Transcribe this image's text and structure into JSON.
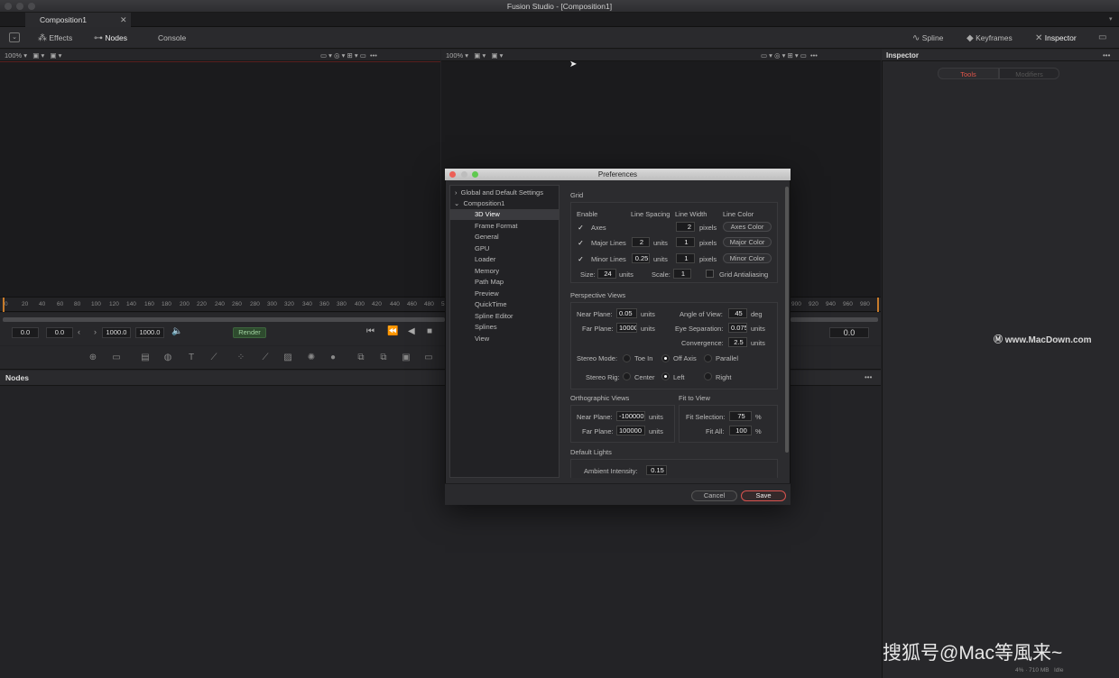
{
  "window": {
    "title": "Fusion Studio - [Composition1]"
  },
  "tabs": [
    {
      "label": "Composition1"
    }
  ],
  "toolbar": {
    "effects": "Effects",
    "nodes": "Nodes",
    "console": "Console",
    "spline": "Spline",
    "keyframes": "Keyframes",
    "inspector": "Inspector"
  },
  "viewer_left": {
    "zoom": "100%"
  },
  "viewer_right": {
    "zoom": "100%"
  },
  "ruler": {
    "ticks": [
      "0",
      "20",
      "40",
      "60",
      "80",
      "100",
      "120",
      "140",
      "160",
      "180",
      "200",
      "220",
      "240",
      "260",
      "280",
      "300",
      "320",
      "340",
      "360",
      "380",
      "400",
      "420",
      "440",
      "460",
      "480",
      "5",
      "900",
      "920",
      "940",
      "960",
      "980"
    ]
  },
  "transport": {
    "start": "0.0",
    "current_start": "0.0",
    "end": "1000.0",
    "render_end": "1000.0",
    "render": "Render",
    "current_time": "0.0"
  },
  "nodes_panel": {
    "title": "Nodes"
  },
  "inspector": {
    "title": "Inspector",
    "tools": "Tools",
    "modifiers": "Modifiers"
  },
  "watermark": {
    "macdown": "www.MacDown.com",
    "sohu": "搜狐号@Mac等風来~"
  },
  "status": {
    "memory": "4% · 710 MB",
    "state": "Idle"
  },
  "preferences": {
    "title": "Preferences",
    "tree": [
      {
        "label": "Global and Default Settings"
      },
      {
        "label": "Composition1"
      },
      {
        "label": "3D View"
      },
      {
        "label": "Frame Format"
      },
      {
        "label": "General"
      },
      {
        "label": "GPU"
      },
      {
        "label": "Loader"
      },
      {
        "label": "Memory"
      },
      {
        "label": "Path Map"
      },
      {
        "label": "Preview"
      },
      {
        "label": "QuickTime"
      },
      {
        "label": "Spline Editor"
      },
      {
        "label": "Splines"
      },
      {
        "label": "View"
      }
    ],
    "grid": {
      "title": "Grid",
      "headers": {
        "enable": "Enable",
        "spacing": "Line Spacing",
        "width": "Line Width",
        "color": "Line Color"
      },
      "axes": {
        "label": "Axes",
        "width": "2",
        "unit": "pixels",
        "color_btn": "Axes Color"
      },
      "major": {
        "label": "Major Lines",
        "spacing": "2",
        "spacing_unit": "units",
        "width": "1",
        "unit": "pixels",
        "color_btn": "Major Color"
      },
      "minor": {
        "label": "Minor Lines",
        "spacing": "0.25",
        "spacing_unit": "units",
        "width": "1",
        "unit": "pixels",
        "color_btn": "Minor Color"
      },
      "size_label": "Size:",
      "size": "24",
      "size_unit": "units",
      "scale_label": "Scale:",
      "scale": "1",
      "antialias": "Grid Antialiasing"
    },
    "perspective": {
      "title": "Perspective Views",
      "near_label": "Near Plane:",
      "near": "0.05",
      "near_unit": "units",
      "far_label": "Far Plane:",
      "far": "10000",
      "far_unit": "units",
      "aov_label": "Angle of View:",
      "aov": "45",
      "aov_unit": "deg",
      "eye_label": "Eye Separation:",
      "eye": "0.075",
      "eye_unit": "units",
      "conv_label": "Convergence:",
      "conv": "2.5",
      "conv_unit": "units",
      "stereo_mode_label": "Stereo Mode:",
      "toe_in": "Toe In",
      "off_axis": "Off Axis",
      "parallel": "Parallel",
      "stereo_rig_label": "Stereo Rig:",
      "center": "Center",
      "left": "Left",
      "right": "Right"
    },
    "ortho": {
      "title": "Orthographic Views",
      "near_label": "Near Plane:",
      "near": "-100000",
      "near_unit": "units",
      "far_label": "Far Plane:",
      "far": "100000",
      "far_unit": "units"
    },
    "fit": {
      "title": "Fit to View",
      "sel_label": "Fit Selection:",
      "sel": "75",
      "sel_unit": "%",
      "all_label": "Fit All:",
      "all": "100",
      "all_unit": "%"
    },
    "lights": {
      "title": "Default Lights",
      "ambient_label": "Ambient Intensity:",
      "ambient": "0.15"
    },
    "cancel": "Cancel",
    "save": "Save"
  }
}
